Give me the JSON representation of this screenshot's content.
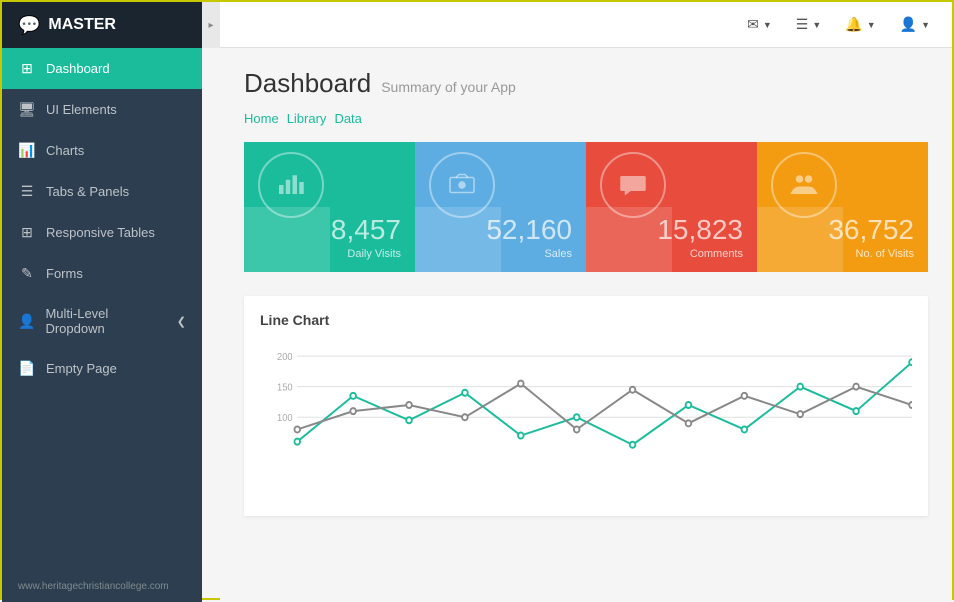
{
  "app": {
    "name": "MASTER",
    "logo_icon": "💬"
  },
  "sidebar": {
    "items": [
      {
        "id": "dashboard",
        "label": "Dashboard",
        "icon": "⊞",
        "active": true
      },
      {
        "id": "ui-elements",
        "label": "UI Elements",
        "icon": "🖥",
        "active": false
      },
      {
        "id": "charts",
        "label": "Charts",
        "icon": "📊",
        "active": false
      },
      {
        "id": "tabs-panels",
        "label": "Tabs & Panels",
        "icon": "☰",
        "active": false
      },
      {
        "id": "responsive-tables",
        "label": "Responsive Tables",
        "icon": "⊞",
        "active": false
      },
      {
        "id": "forms",
        "label": "Forms",
        "icon": "✎",
        "active": false
      },
      {
        "id": "multi-level",
        "label": "Multi-Level Dropdown",
        "icon": "👤",
        "active": false,
        "has_arrow": true
      },
      {
        "id": "empty-page",
        "label": "Empty Page",
        "icon": "📄",
        "active": false
      }
    ]
  },
  "topbar": {
    "icons": [
      {
        "id": "email",
        "icon": "✉",
        "label": "email-icon"
      },
      {
        "id": "list",
        "icon": "☰",
        "label": "list-icon"
      },
      {
        "id": "bell",
        "icon": "🔔",
        "label": "bell-icon"
      },
      {
        "id": "user",
        "icon": "👤",
        "label": "user-icon"
      }
    ]
  },
  "page": {
    "title": "Dashboard",
    "subtitle": "Summary of your App"
  },
  "breadcrumb": {
    "items": [
      "Home",
      "Library",
      "Data"
    ]
  },
  "stats": [
    {
      "id": "daily-visits",
      "value": "8,457",
      "label": "Daily Visits",
      "color": "green",
      "icon": "📊"
    },
    {
      "id": "sales",
      "value": "52,160",
      "label": "Sales",
      "color": "blue",
      "icon": "🛒"
    },
    {
      "id": "comments",
      "value": "15,823",
      "label": "Comments",
      "color": "red",
      "icon": "💬"
    },
    {
      "id": "num-visits",
      "value": "36,752",
      "label": "No. of Visits",
      "color": "orange",
      "icon": "👥"
    }
  ],
  "chart": {
    "title": "Line Chart",
    "y_labels": [
      "200",
      "150",
      "100"
    ],
    "series": {
      "teal": [
        40,
        120,
        85,
        130,
        60,
        90,
        50,
        110,
        75,
        140,
        100,
        170
      ],
      "gray": [
        60,
        100,
        110,
        90,
        140,
        70,
        130,
        80,
        120,
        95,
        140,
        110
      ]
    }
  },
  "footer": {
    "text": "www.heritagechristiancollege.com"
  }
}
